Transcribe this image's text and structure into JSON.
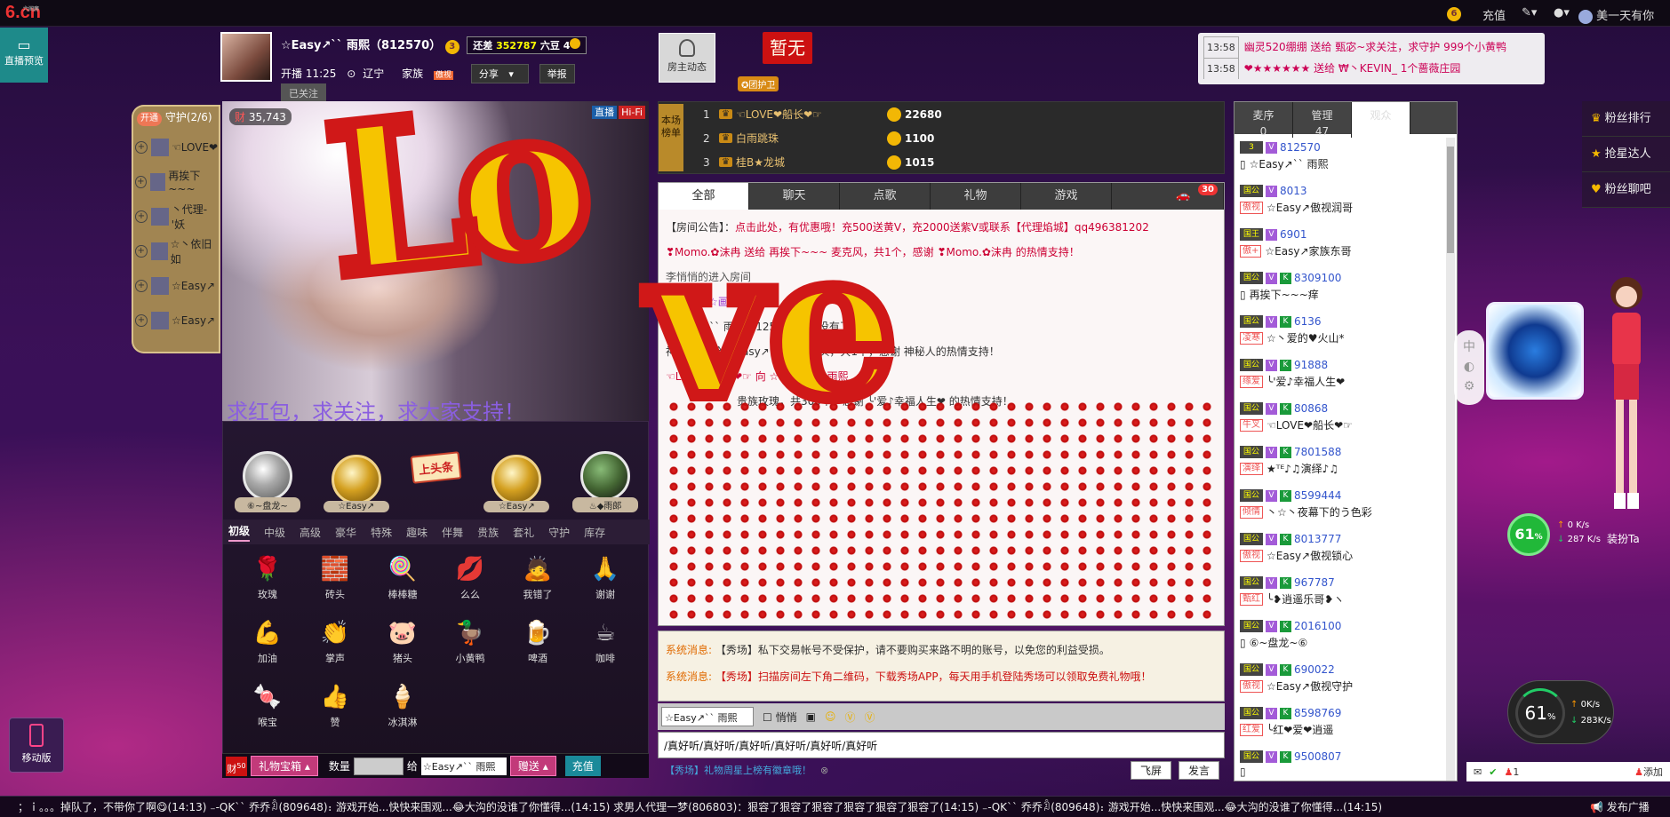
{
  "topbar": {
    "logo": "6.cn",
    "logo_small": "六间房",
    "coin_count": "6",
    "recharge": "充值",
    "username": "美一天有你"
  },
  "side": {
    "preview": "直播预览",
    "mobile": "移动版"
  },
  "host": {
    "name": "☆Easy↗`` 雨熙（812570）",
    "level": "3",
    "remain_label": "还差",
    "remain_value": "352787",
    "remain_unit": "六豆",
    "remain_level": "4",
    "live_time": "开播 11:25",
    "location": "辽宁",
    "family": "家族",
    "family_tag": "傲视",
    "share": "分享",
    "report": "举报",
    "followed": "已关注",
    "dynamics": "房主动态",
    "banner": "暂无",
    "guard": "团护卫"
  },
  "notices": [
    {
      "time": "13:58",
      "text": "幽灵520绷绷 送给 甄宓~求关注，求守护 999个小黄鸭"
    },
    {
      "time": "13:58",
      "text": "❤★★★★★★ 送给 ₩丶KEVIN_ 1个蔷薇庄园"
    }
  ],
  "guardlist": {
    "open": "开通",
    "title": "守护(2/6)",
    "items": [
      "☜LOVE❤",
      "再挨下~~~",
      "丶代理-'妖",
      "☆丶依旧如",
      "☆Easy↗",
      "☆Easy↗"
    ]
  },
  "video": {
    "viewers": "35,743",
    "mode_live": "直播",
    "mode_hifi": "Hi-Fi",
    "marquee": "求红包，求关注，求大家支持！"
  },
  "rankavatars": [
    "⑥~盘龙~",
    "☆Easy↗",
    "☆Easy↗",
    "♨◆雨郞"
  ],
  "headline_btn": "上头条",
  "gift_tabs": [
    "初级",
    "中级",
    "高级",
    "豪华",
    "特殊",
    "趣味",
    "伴舞",
    "贵族",
    "套礼",
    "守护",
    "库存"
  ],
  "gifts": [
    {
      "name": "玫瑰",
      "glyph": "🌹"
    },
    {
      "name": "砖头",
      "glyph": "🧱"
    },
    {
      "name": "棒棒糖",
      "glyph": "🍭"
    },
    {
      "name": "么么",
      "glyph": "💋"
    },
    {
      "name": "我错了",
      "glyph": "🙇"
    },
    {
      "name": "谢谢",
      "glyph": "🙏"
    },
    {
      "name": "加油",
      "glyph": "💪"
    },
    {
      "name": "掌声",
      "glyph": "👏"
    },
    {
      "name": "猪头",
      "glyph": "🐷"
    },
    {
      "name": "小黄鸭",
      "glyph": "🦆"
    },
    {
      "name": "啤酒",
      "glyph": "🍺"
    },
    {
      "name": "咖啡",
      "glyph": "☕"
    },
    {
      "name": "喉宝",
      "glyph": "🍬"
    },
    {
      "name": "赞",
      "glyph": "👍"
    },
    {
      "name": "冰淇淋",
      "glyph": "🍦"
    }
  ],
  "giftbar": {
    "badge": "50",
    "box": "礼物宝箱",
    "qty_label": "数量",
    "to_label": "给",
    "to_value": "☆Easy↗`` 雨熙",
    "send": "赠送",
    "recharge": "充值"
  },
  "scoreboard": {
    "tag": "本场榜单",
    "rows": [
      {
        "rank": "1",
        "name": "☜LOVE❤船长❤☞",
        "score": "22680"
      },
      {
        "rank": "2",
        "name": "白雨跳珠",
        "score": "1100"
      },
      {
        "rank": "3",
        "name": "桂B★龙城",
        "score": "1015"
      }
    ]
  },
  "chattabs": [
    "全部",
    "聊天",
    "点歌",
    "礼物",
    "游戏"
  ],
  "chat_car_count": "30",
  "chat": {
    "announce_label": "【房间公告】：",
    "announce": "点击此处，有优惠哦！充500送黄V，充2000送紫V或联系【代理焰城】qq496381202",
    "lines": [
      "❣Momo.✿沫冉 送给 再挨下~~~ 麦克风，共1个，感谢 ❣Momo.✿沫冉 的热情支持！",
      "李悄悄的进入房间",
      "【国核】☆画",
      "☆Easy↗`` 雨熙[812570] 说：没有了 😁",
      "神秘人 送给 ☆Easy↗`` 雨熙 砖头，共1个，感谢 神秘人的热情支持！",
      "☜LOVE❤船长❤☞ 向 ☆Easy↗`` 雨熙",
      "贵族玫瑰，共300个，感谢 ╰'爱♪幸福人生❤ 的热情支持！"
    ]
  },
  "system": {
    "label": "系统消息:",
    "lines": [
      "【秀场】私下交易帐号不受保护，请不要购买来路不明的账号，以免您的利益受损。",
      "【秀场】扫描房间左下角二维码，下载秀场APP，每天用手机登陆秀场可以领取免费礼物哦！"
    ]
  },
  "chattools": {
    "target": "☆Easy↗`` 雨熙",
    "whisper": "悄悄"
  },
  "chatinput": "/真好听/真好听/真好听/真好听/真好听/真好听",
  "chatfoot": {
    "text": "【秀场】礼物周星上榜有徽章哦！",
    "fly": "飞屏",
    "send": "发言"
  },
  "usertabs": [
    {
      "label": "麦序",
      "count": "0"
    },
    {
      "label": "管理",
      "count": "47"
    },
    {
      "label": "观众",
      "count": ""
    }
  ],
  "users": [
    {
      "badge": "3",
      "id": "812570",
      "tag": "",
      "name": "☆Easy↗`` 雨熙"
    },
    {
      "badge": "国公",
      "id": "8013",
      "tag": "傲视",
      "name": "☆Easy↗傲视润哥"
    },
    {
      "badge": "国王",
      "id": "6901",
      "tag": "傲+",
      "name": "☆Easy↗家族东哥"
    },
    {
      "badge": "国公",
      "id": "8309100",
      "tag": "",
      "name": "再挨下~~~痒"
    },
    {
      "badge": "国公",
      "id": "6136",
      "tag": "凌寒",
      "name": "☆丶爱的♥火山*"
    },
    {
      "badge": "国公",
      "id": "91888",
      "tag": "缘爱",
      "name": "╰'爱♪幸福人生❤"
    },
    {
      "badge": "国公",
      "id": "80868",
      "tag": "牛叉",
      "name": "☜LOVE❤船长❤☞"
    },
    {
      "badge": "国公",
      "id": "7801588",
      "tag": "演绎",
      "name": "★ᵀᴱ♪♫演绎♪♫"
    },
    {
      "badge": "国公",
      "id": "8599444",
      "tag": "倾情",
      "name": "丶☆丶夜幕下的う色彩"
    },
    {
      "badge": "国公",
      "id": "8013777",
      "tag": "傲视",
      "name": "☆Easy↗傲视锁心"
    },
    {
      "badge": "国公",
      "id": "967787",
      "tag": "甄红",
      "name": "╰❥逍遥乐哥❥ヽ"
    },
    {
      "badge": "国公",
      "id": "2016100",
      "tag": "",
      "name": "⑥~盘龙~⑥"
    },
    {
      "badge": "国公",
      "id": "690022",
      "tag": "傲视",
      "name": "☆Easy↗傲视守护"
    },
    {
      "badge": "国公",
      "id": "8598769",
      "tag": "红爱",
      "name": "╰红❤爱❤逍遥"
    },
    {
      "badge": "国公",
      "id": "9500807",
      "tag": "",
      "name": ""
    }
  ],
  "rmenu": [
    "粉丝排行",
    "抢星达人",
    "粉丝聊吧"
  ],
  "perf": {
    "cpu1": "61",
    "up1": "0 K/s",
    "down1": "287 K/s",
    "try": "装扮Ta",
    "cpu2": "61",
    "up2": "0K/s",
    "down2": "283K/s"
  },
  "msgbox": {
    "count": "1",
    "add": "添加"
  },
  "bottom": {
    "marquee": "；ｉ。。。掉队了，不带你了啊😋(14:13)    ₋-QK`` 乔乔ꀢ(809648)：游戏开始...快快来围观...😂大沟的没谁了你懂得...(14:15)    求男人代理一梦(806803)：狠容了狠容了狠容了狠容了狠容了狠容了(14:15)    ₋-QK`` 乔乔ꀢ(809648)：游戏开始...快快来围观...😂大沟的没谁了你懂得...(14:15)",
    "publish": "发布广播"
  }
}
